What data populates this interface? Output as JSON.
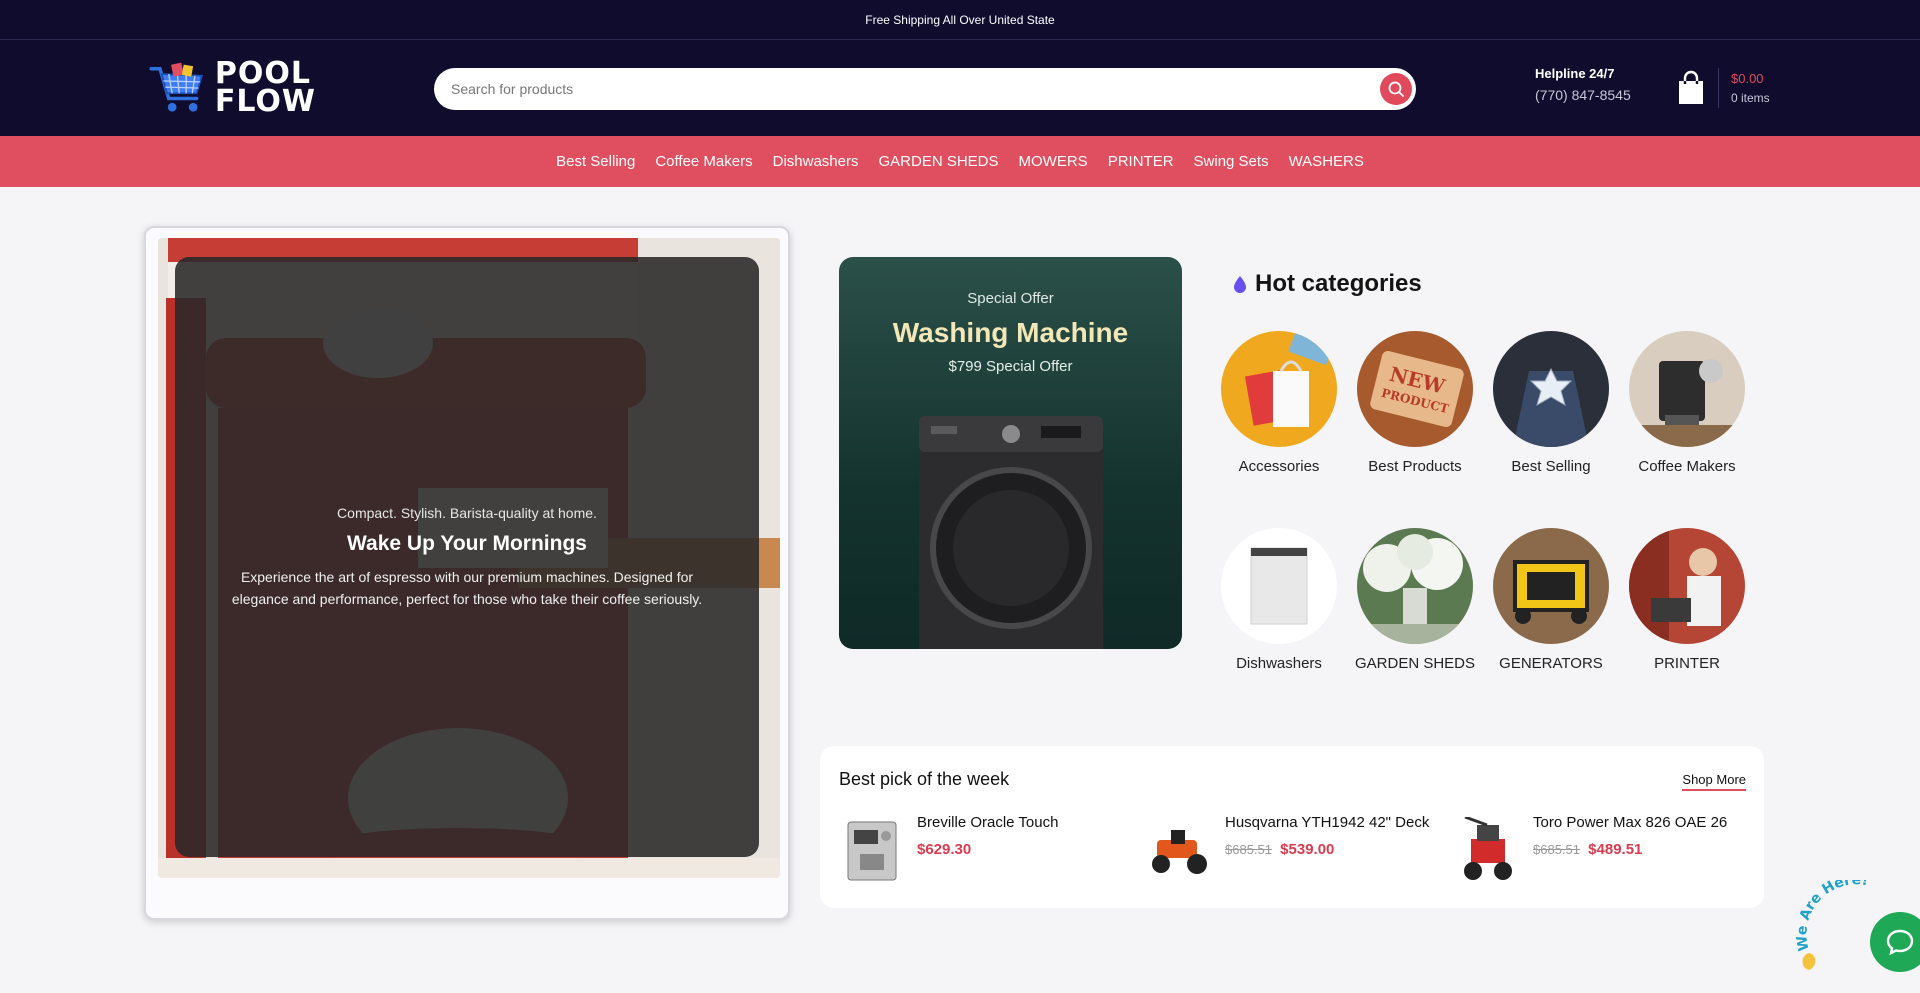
{
  "topbar": {
    "text": "Free Shipping All Over United State"
  },
  "header": {
    "logo_line1": "POOL",
    "logo_line2": "FLOW",
    "search_placeholder": "Search for products",
    "helpline_title": "Helpline 24/7",
    "helpline_phone": "(770) 847-8545",
    "cart_amount": "$0.00",
    "cart_items": "0 items"
  },
  "nav": {
    "items": [
      "Best Selling",
      "Coffee Makers",
      "Dishwashers",
      "GARDEN SHEDS",
      "MOWERS",
      "PRINTER",
      "Swing Sets",
      "WASHERS"
    ]
  },
  "hero": {
    "subtitle": "Compact. Stylish. Barista-quality at home.",
    "title": "Wake Up Your Mornings",
    "description": "Experience the art of espresso with our premium machines. Designed for elegance and performance, perfect for those who take their coffee seriously."
  },
  "offer": {
    "label": "Special Offer",
    "title": "Washing Machine",
    "price": "$799 Special Offer"
  },
  "hot_categories": {
    "title": "Hot categories",
    "items": [
      {
        "label": "Accessories"
      },
      {
        "label": "Best Products"
      },
      {
        "label": "Best Selling"
      },
      {
        "label": "Coffee Makers"
      },
      {
        "label": "Dishwashers"
      },
      {
        "label": "GARDEN SHEDS"
      },
      {
        "label": "GENERATORS"
      },
      {
        "label": "PRINTER"
      }
    ]
  },
  "best_pick": {
    "title": "Best pick of the week",
    "shop_more": "Shop More",
    "items": [
      {
        "name": "Breville Oracle Touch",
        "old_price": "",
        "price": "$629.30"
      },
      {
        "name": "Husqvarna YTH1942 42\" Deck",
        "old_price": "$685.51",
        "price": "$539.00"
      },
      {
        "name": "Toro Power Max 826 OAE 26",
        "old_price": "$685.51",
        "price": "$489.51"
      }
    ]
  },
  "chat": {
    "label": "We Are Here!"
  },
  "colors": {
    "brand_dark": "#0f0c2e",
    "accent_red": "#e04f5f",
    "price_red": "#d93c4f",
    "chat_green": "#1fa855"
  }
}
